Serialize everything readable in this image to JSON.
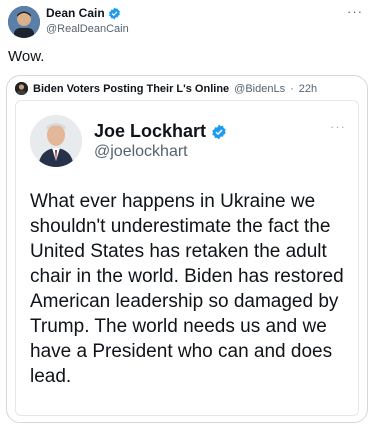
{
  "author": {
    "name": "Dean Cain",
    "handle": "@RealDeanCain"
  },
  "more_glyph": "···",
  "tweet_text": "Wow.",
  "quote": {
    "name": "Biden Voters Posting Their L's Online",
    "handle": "@BidenLs",
    "separator": "·",
    "time": "22h"
  },
  "card": {
    "name": "Joe Lockhart",
    "handle": "@joelockhart",
    "body": "What ever happens in Ukraine we shouldn't underestimate the fact the United States has retaken the adult chair in the world. Biden has restored American leadership so damaged by Trump. The world needs us and we have a President who can and does lead."
  },
  "colors": {
    "verified": "#1d9bf0",
    "secondary_text": "#536471",
    "border": "#cfd9de"
  },
  "icons": [
    "verified-badge-icon",
    "more-options-icon"
  ]
}
